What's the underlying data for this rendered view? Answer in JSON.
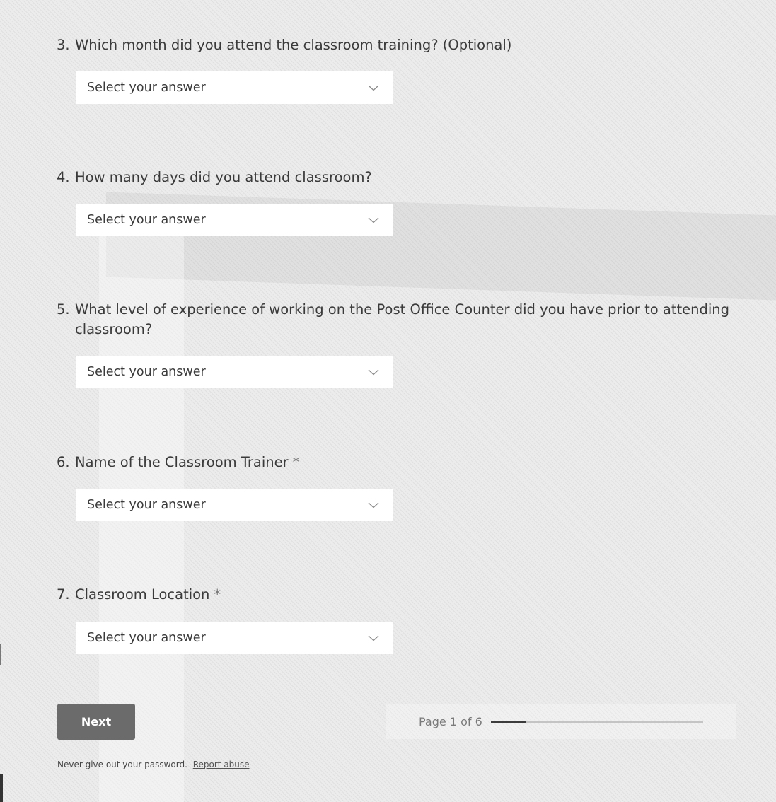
{
  "questions": [
    {
      "number": "3.",
      "text": "Which month did you attend the classroom training? (Optional)",
      "required": "",
      "placeholder": "Select your answer"
    },
    {
      "number": "4.",
      "text": "How many days did you attend classroom?",
      "required": "",
      "placeholder": "Select your answer"
    },
    {
      "number": "5.",
      "text": "What level of experience of working on the Post Office Counter did you have prior to attending classroom?",
      "required": "",
      "placeholder": "Select your answer"
    },
    {
      "number": "6.",
      "text": "Name of the Classroom Trainer",
      "required": "*",
      "placeholder": "Select your answer"
    },
    {
      "number": "7.",
      "text": "Classroom Location",
      "required": "*",
      "placeholder": "Select your answer"
    }
  ],
  "navigation": {
    "next_label": "Next",
    "page_label": "Page 1 of 6",
    "progress_fraction": 0.1667
  },
  "footer": {
    "notice": "Never give out your password.",
    "report_link": "Report abuse"
  },
  "icons": {
    "dropdown": "chevron-down-icon"
  },
  "colors": {
    "button": "#6b6b6b",
    "select_background": "#ffffff",
    "progress_fill": "#3c3c3c",
    "progress_track": "#c4c4c4"
  }
}
